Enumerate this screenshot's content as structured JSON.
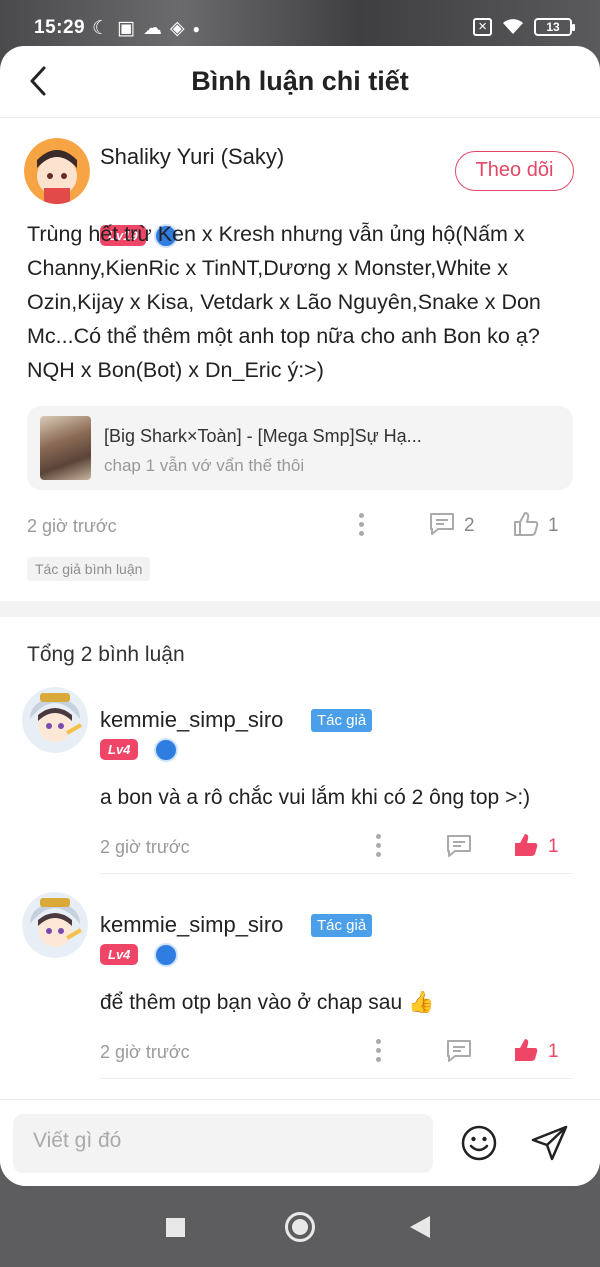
{
  "status_bar": {
    "time": "15:29",
    "battery": "13"
  },
  "header": {
    "title": "Bình luận chi tiết"
  },
  "main_comment": {
    "user_name": "Shaliky Yuri (Saky)",
    "level": "Lv19",
    "follow_label": "Theo dõi",
    "text": "Trùng hết trừ Ken x Kresh nhưng vẫn ủng hộ(Nấm x Channy,KienRic x TinNT,Dương x Monster,White x Ozin,Kijay x Kisa, Vetdark x Lão Nguyên,Snake x Don Mc...Có thể thêm một anh top nữa cho anh Bon ko ạ? NQH x Bon(Bot) x Dn_Eric ý:>)",
    "story_card": {
      "title": "[Big Shark×Toàn] - [Mega Smp]Sự Hạ...",
      "subtitle": "chap 1 vẫn vớ vẩn thế thôi"
    },
    "time": "2 giờ trước",
    "reply_count": "2",
    "like_count": "1",
    "author_tag": "Tác giả bình luận"
  },
  "total_label": "Tổng 2 bình luận",
  "replies": [
    {
      "user_name": "kemmie_simp_siro",
      "author_tag": "Tác giả",
      "level": "Lv4",
      "text": "a bon và a rô chắc vui lắm khi có 2 ông top >:)",
      "time": "2 giờ trước",
      "like_count": "1"
    },
    {
      "user_name": "kemmie_simp_siro",
      "author_tag": "Tác giả",
      "level": "Lv4",
      "text": "để thêm otp bạn vào ở chap sau 👍",
      "time": "2 giờ trước",
      "like_count": "1"
    }
  ],
  "composer": {
    "placeholder": "Viết gì đó"
  },
  "colors": {
    "accent": "#e24865",
    "author_blue": "#4a9fe8",
    "like_red": "#ef4566"
  }
}
